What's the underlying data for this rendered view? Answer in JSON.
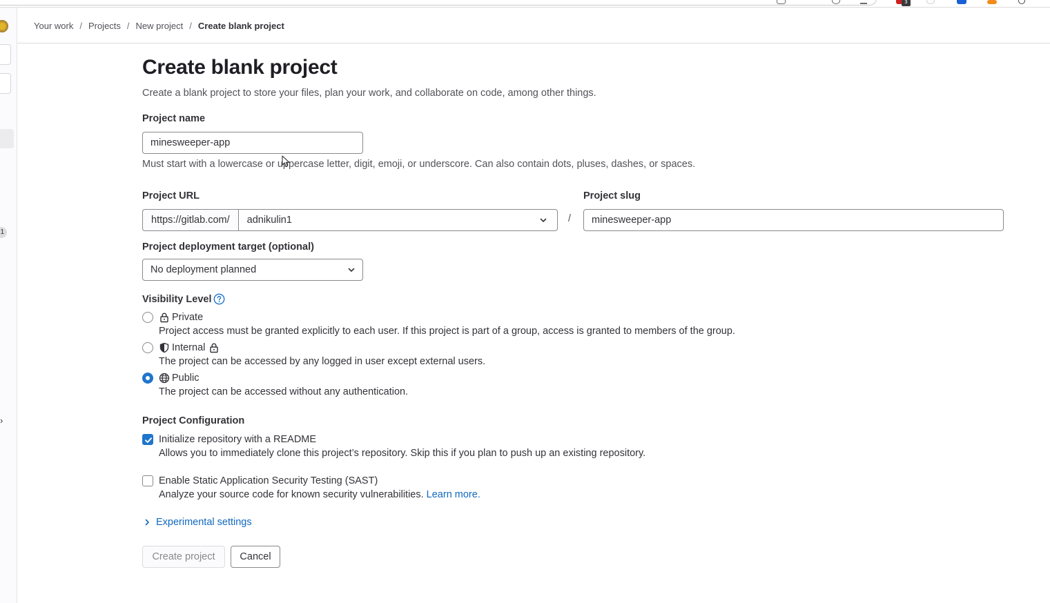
{
  "breadcrumb": {
    "items": [
      "Your work",
      "Projects",
      "New project"
    ],
    "current": "Create blank project",
    "separator": "/"
  },
  "sidebar": {
    "badge_count": "1"
  },
  "browser": {
    "extension_badge": "3"
  },
  "page": {
    "title": "Create blank project",
    "description": "Create a blank project to store your files, plan your work, and collaborate on code, among other things."
  },
  "project_name": {
    "label": "Project name",
    "value": "minesweeper-app",
    "help": "Must start with a lowercase or uppercase letter, digit, emoji, or underscore. Can also contain dots, pluses, dashes, or spaces."
  },
  "project_url": {
    "label": "Project URL",
    "prefix": "https://gitlab.com/",
    "namespace": "adnikulin1",
    "separator": "/"
  },
  "project_slug": {
    "label": "Project slug",
    "value": "minesweeper-app"
  },
  "deployment": {
    "label": "Project deployment target (optional)",
    "selected": "No deployment planned"
  },
  "visibility": {
    "label": "Visibility Level",
    "options": [
      {
        "label": "Private",
        "help": "Project access must be granted explicitly to each user. If this project is part of a group, access is granted to members of the group.",
        "icon": "lock-icon",
        "checked": false
      },
      {
        "label": "Internal",
        "help": "The project can be accessed by any logged in user except external users.",
        "icon": "shield-icon",
        "checked": false
      },
      {
        "label": "Public",
        "help": "The project can be accessed without any authentication.",
        "icon": "globe-icon",
        "checked": true
      }
    ]
  },
  "configuration": {
    "label": "Project Configuration",
    "readme": {
      "label": "Initialize repository with a README",
      "help": "Allows you to immediately clone this project’s repository. Skip this if you plan to push up an existing repository.",
      "checked": true
    },
    "sast": {
      "label": "Enable Static Application Security Testing (SAST)",
      "help": "Analyze your source code for known security vulnerabilities.",
      "link": "Learn more.",
      "checked": false
    }
  },
  "experimental": {
    "label": "Experimental settings"
  },
  "actions": {
    "create": "Create project",
    "cancel": "Cancel"
  },
  "colors": {
    "primary": "#1f75cb",
    "link": "#1068bf",
    "text": "#333238",
    "border": "#89888d"
  }
}
